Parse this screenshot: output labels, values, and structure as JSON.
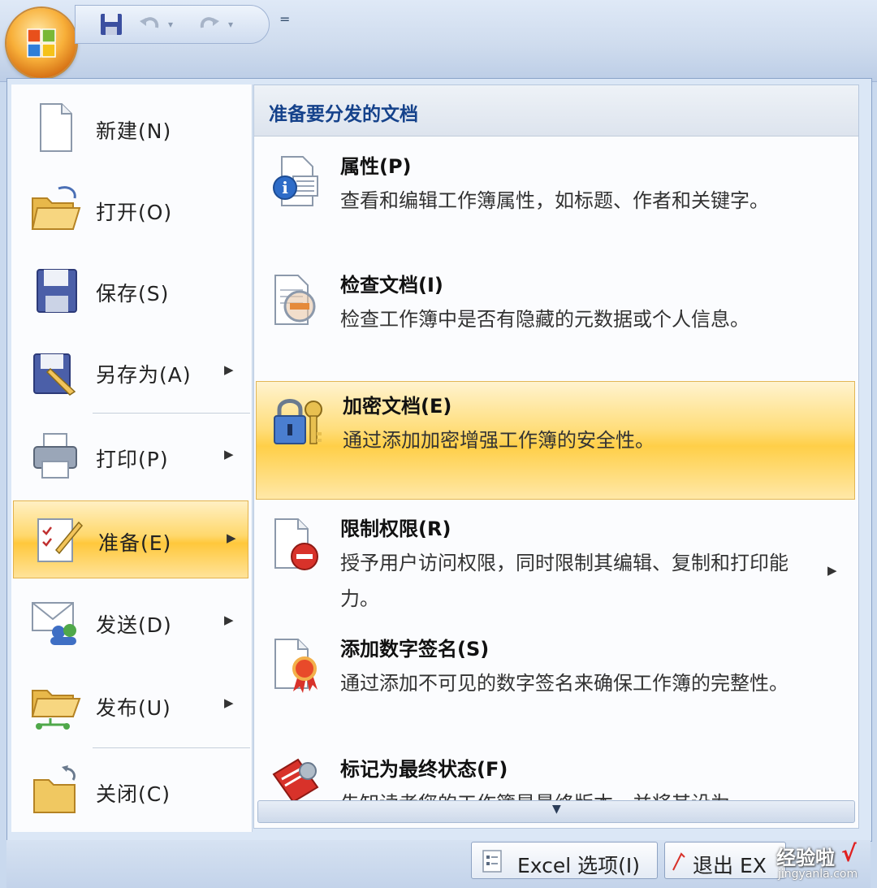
{
  "left_menu": {
    "items": [
      {
        "label": "新建(N)",
        "has_submenu": false
      },
      {
        "label": "打开(O)",
        "has_submenu": false
      },
      {
        "label": "保存(S)",
        "has_submenu": false
      },
      {
        "label": "另存为(A)",
        "has_submenu": true
      },
      {
        "label": "打印(P)",
        "has_submenu": true
      },
      {
        "label": "准备(E)",
        "has_submenu": true,
        "selected": true
      },
      {
        "label": "发送(D)",
        "has_submenu": true
      },
      {
        "label": "发布(U)",
        "has_submenu": true
      },
      {
        "label": "关闭(C)",
        "has_submenu": false
      }
    ],
    "arrow": "▶"
  },
  "submenu": {
    "header": "准备要分发的文档",
    "items": [
      {
        "title": "属性(P)",
        "desc": "查看和编辑工作簿属性，如标题、作者和关键字。"
      },
      {
        "title": "检查文档(I)",
        "desc": "检查工作簿中是否有隐藏的元数据或个人信息。"
      },
      {
        "title": "加密文档(E)",
        "desc": "通过添加加密增强工作簿的安全性。",
        "highlighted": true
      },
      {
        "title": "限制权限(R)",
        "desc": "授予用户访问权限，同时限制其编辑、复制和打印能力。",
        "has_submenu": true
      },
      {
        "title": "添加数字签名(S)",
        "desc": "通过添加不可见的数字签名来确保工作簿的完整性。"
      },
      {
        "title": "标记为最终状态(F)",
        "desc": "先知读者您的工作簿是最终版本，并将其设为"
      }
    ],
    "scroll_arrow": "▼",
    "arrow": "▶"
  },
  "quick_access": {
    "more": "="
  },
  "footer": {
    "options_label": "Excel 选项(I)",
    "exit_label": "退出 EX",
    "watermark": "经验啦",
    "watermark_check": "√",
    "watermark_url": "jingyanla.com"
  },
  "colors": {
    "highlight": "#ffd86c",
    "header_text": "#15428b"
  }
}
